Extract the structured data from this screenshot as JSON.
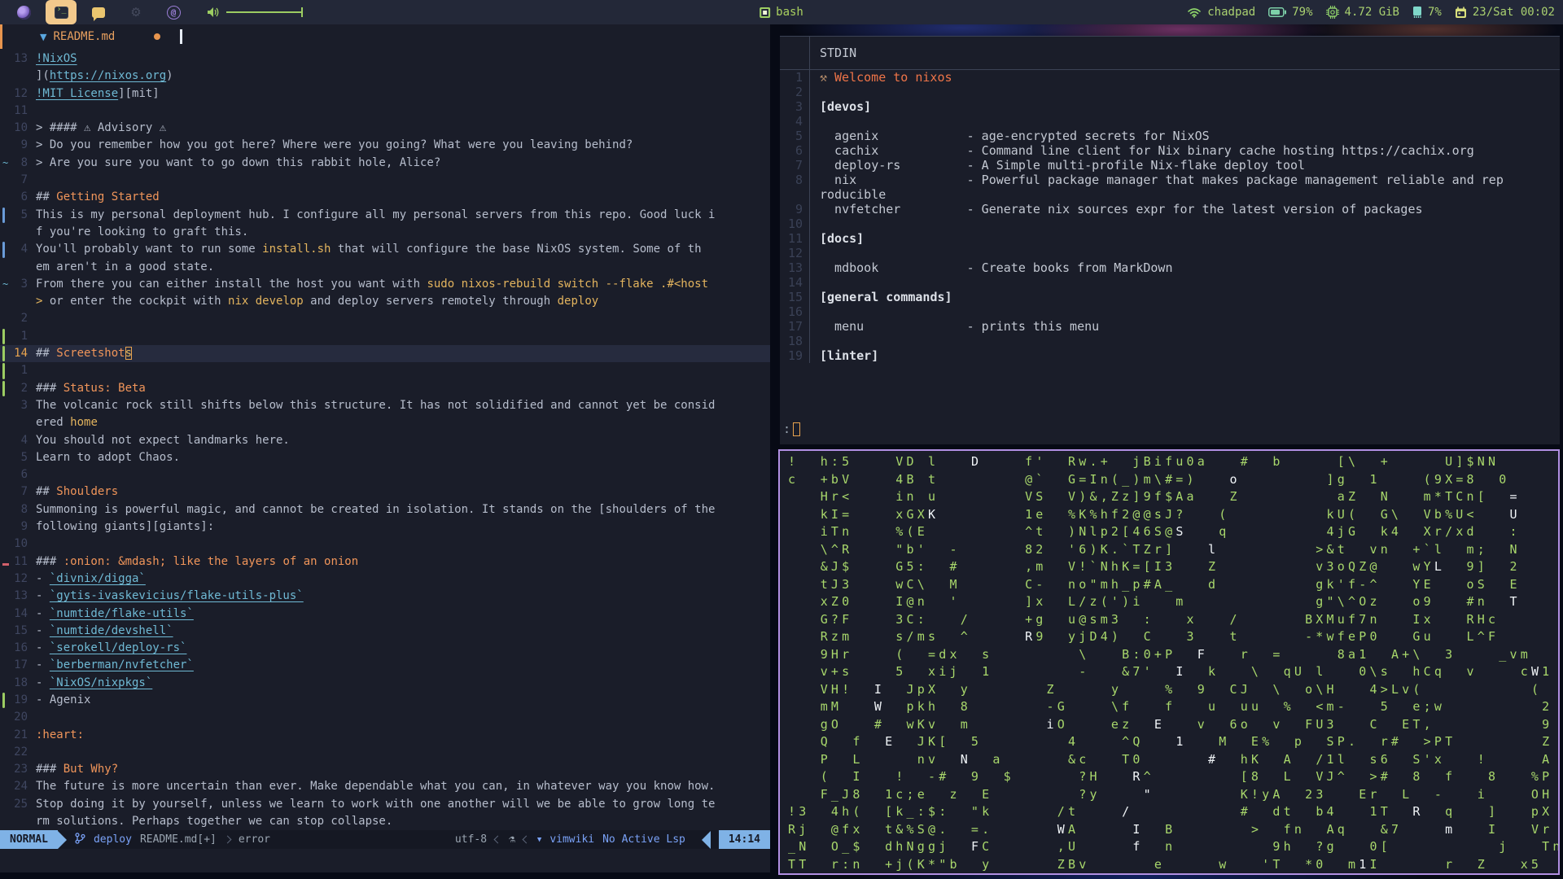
{
  "colors": {
    "accent_orange": "#f0955a",
    "accent_blue": "#7aa2f7",
    "green": "#a9d070",
    "link_cyan": "#6fb9d4",
    "code_yellow": "#e3b45e",
    "matrix_green": "#a8d76b",
    "window_border": "#b18fe2",
    "mode_bg": "#7fb2e6"
  },
  "topbar": {
    "workspaces": [
      {
        "name": "browser",
        "active": false
      },
      {
        "name": "terminal",
        "active": true
      },
      {
        "name": "chat",
        "active": false
      },
      {
        "name": "settings",
        "active": false
      },
      {
        "name": "social",
        "active": false
      }
    ],
    "center": {
      "window_title": "bash"
    },
    "tray": {
      "host": "chadpad",
      "battery": "79%",
      "memory": "4.72 GiB",
      "cpu": "7%",
      "clock": "23/Sat 00:02"
    }
  },
  "editor": {
    "tab": {
      "filename": "README.md",
      "modified": true
    },
    "rows": [
      {
        "n": "13",
        "g": "",
        "s": [
          [
            "l",
            "!NixOS"
          ]
        ]
      },
      {
        "n": "",
        "g": "",
        "s": [
          [
            "t",
            "]("
          ],
          [
            "l",
            "https://nixos.org"
          ],
          [
            "t",
            ")"
          ]
        ]
      },
      {
        "n": "12",
        "g": "",
        "s": [
          [
            "l",
            "!MIT License"
          ],
          [
            "t",
            "][mit]"
          ]
        ]
      },
      {
        "n": "11",
        "g": "",
        "s": []
      },
      {
        "n": "10",
        "g": "",
        "s": [
          [
            "t",
            "> #### ⚠ Advisory ⚠"
          ]
        ]
      },
      {
        "n": "9",
        "g": "",
        "s": [
          [
            "t",
            "> Do you remember how you got here? Where were you going? What were you leaving behind?"
          ]
        ]
      },
      {
        "n": "8",
        "g": "t",
        "s": [
          [
            "t",
            "> Are you sure you want to go down this rabbit hole, Alice?"
          ]
        ]
      },
      {
        "n": "7",
        "g": "",
        "s": []
      },
      {
        "n": "6",
        "g": "",
        "s": [
          [
            "t",
            "## "
          ],
          [
            "h",
            "Getting Started"
          ]
        ]
      },
      {
        "n": "5",
        "g": "b",
        "s": [
          [
            "t",
            "This is my personal deployment hub. I configure all my personal servers from this repo. Good luck i"
          ]
        ]
      },
      {
        "n": "",
        "g": "",
        "s": [
          [
            "t",
            "f you're looking to graft this."
          ]
        ]
      },
      {
        "n": "4",
        "g": "b",
        "s": [
          [
            "t",
            "You'll probably want to run some "
          ],
          [
            "c",
            "install.sh"
          ],
          [
            "t",
            " that will configure the base NixOS system. Some of th"
          ]
        ]
      },
      {
        "n": "",
        "g": "",
        "s": [
          [
            "t",
            "em aren't in a good state."
          ]
        ]
      },
      {
        "n": "3",
        "g": "t",
        "s": [
          [
            "t",
            "From there you can either install the host you want with "
          ],
          [
            "c",
            "sudo nixos-rebuild switch --flake .#<host"
          ]
        ]
      },
      {
        "n": "",
        "g": "",
        "s": [
          [
            "c",
            "> "
          ],
          [
            "t",
            "or enter the cockpit with "
          ],
          [
            "c",
            "nix develop"
          ],
          [
            "t",
            " and deploy servers remotely through "
          ],
          [
            "c",
            "deploy"
          ]
        ]
      },
      {
        "n": "2",
        "g": "",
        "s": []
      },
      {
        "n": "1",
        "g": "g",
        "s": []
      },
      {
        "n": "14",
        "g": "g",
        "cur": true,
        "s": [
          [
            "t",
            "## "
          ],
          [
            "h",
            "Screetshot"
          ],
          [
            "x",
            "s"
          ]
        ]
      },
      {
        "n": "1",
        "g": "g",
        "s": []
      },
      {
        "n": "2",
        "g": "g",
        "s": [
          [
            "t",
            "### "
          ],
          [
            "h",
            "Status: Beta"
          ]
        ]
      },
      {
        "n": "3",
        "g": "",
        "s": [
          [
            "t",
            "The volcanic rock still shifts below this structure. It has not solidified and cannot yet be consid"
          ]
        ]
      },
      {
        "n": "",
        "g": "",
        "s": [
          [
            "t",
            "ered "
          ],
          [
            "c",
            "home"
          ]
        ]
      },
      {
        "n": "4",
        "g": "",
        "s": [
          [
            "t",
            "You should not expect landmarks here."
          ]
        ]
      },
      {
        "n": "5",
        "g": "",
        "s": [
          [
            "t",
            "Learn to adopt Chaos."
          ]
        ]
      },
      {
        "n": "6",
        "g": "",
        "s": []
      },
      {
        "n": "7",
        "g": "",
        "s": [
          [
            "t",
            "## "
          ],
          [
            "h",
            "Shoulders"
          ]
        ]
      },
      {
        "n": "8",
        "g": "",
        "s": [
          [
            "t",
            "Summoning is powerful magic, and cannot be created in isolation. It stands on the [shoulders of the"
          ]
        ]
      },
      {
        "n": "9",
        "g": "",
        "s": [
          [
            "t",
            "following giants][giants]:"
          ]
        ]
      },
      {
        "n": "10",
        "g": "",
        "s": []
      },
      {
        "n": "11",
        "g": "r",
        "s": [
          [
            "t",
            "### "
          ],
          [
            "h",
            ":onion: &mdash; like the layers of an onion"
          ]
        ]
      },
      {
        "n": "12",
        "g": "",
        "s": [
          [
            "t",
            "- "
          ],
          [
            "l",
            "`divnix/digga`"
          ]
        ]
      },
      {
        "n": "13",
        "g": "",
        "s": [
          [
            "t",
            "- "
          ],
          [
            "l",
            "`gytis-ivaskevicius/flake-utils-plus`"
          ]
        ]
      },
      {
        "n": "14",
        "g": "",
        "s": [
          [
            "t",
            "- "
          ],
          [
            "l",
            "`numtide/flake-utils`"
          ]
        ]
      },
      {
        "n": "15",
        "g": "",
        "s": [
          [
            "t",
            "- "
          ],
          [
            "l",
            "`numtide/devshell`"
          ]
        ]
      },
      {
        "n": "16",
        "g": "",
        "s": [
          [
            "t",
            "- "
          ],
          [
            "l",
            "`serokell/deploy-rs`"
          ]
        ]
      },
      {
        "n": "17",
        "g": "",
        "s": [
          [
            "t",
            "- "
          ],
          [
            "l",
            "`berberman/nvfetcher`"
          ]
        ]
      },
      {
        "n": "18",
        "g": "",
        "s": [
          [
            "t",
            "- "
          ],
          [
            "l",
            "`NixOS/nixpkgs`"
          ]
        ]
      },
      {
        "n": "19",
        "g": "g",
        "s": [
          [
            "t",
            "- Agenix"
          ]
        ]
      },
      {
        "n": "20",
        "g": "",
        "s": []
      },
      {
        "n": "21",
        "g": "",
        "s": [
          [
            "h",
            ":heart:"
          ]
        ]
      },
      {
        "n": "22",
        "g": "",
        "s": []
      },
      {
        "n": "23",
        "g": "",
        "s": [
          [
            "t",
            "### "
          ],
          [
            "h",
            "But Why?"
          ]
        ]
      },
      {
        "n": "24",
        "g": "",
        "s": [
          [
            "t",
            "The future is more uncertain than ever. Make dependable what you can, in whatever way you know how."
          ]
        ]
      },
      {
        "n": "25",
        "g": "",
        "s": [
          [
            "t",
            "Stop doing it by yourself, unless we learn to work with one another will we be able to grow long te"
          ]
        ]
      },
      {
        "n": "",
        "g": "",
        "s": [
          [
            "t",
            "rm solutions. Perhaps together we can stop collapse."
          ]
        ]
      }
    ],
    "statusbar": {
      "mode": "NORMAL",
      "branch": "deploy",
      "file": "README.md[+]",
      "diagnostic": "error",
      "encoding": "utf-8",
      "filetype_icon": "⚗",
      "plugin_icon": "▼",
      "plugin": "vimwiki",
      "lsp": "No Active Lsp",
      "time": "14:14"
    }
  },
  "pager": {
    "title": "STDIN",
    "welcome_icon": "⚒",
    "prompt": ":",
    "rows": [
      {
        "n": "1",
        "c": "wel",
        "t": "Welcome to nixos"
      },
      {
        "n": "2",
        "c": "it",
        "t": ""
      },
      {
        "n": "3",
        "c": "sec",
        "t": "[devos]"
      },
      {
        "n": "4",
        "c": "it",
        "t": ""
      },
      {
        "n": "5",
        "c": "it",
        "t": "  agenix            - age-encrypted secrets for NixOS"
      },
      {
        "n": "6",
        "c": "it",
        "t": "  cachix            - Command line client for Nix binary cache hosting https://cachix.org"
      },
      {
        "n": "7",
        "c": "it",
        "t": "  deploy-rs         - A Simple multi-profile Nix-flake deploy tool"
      },
      {
        "n": "8",
        "c": "it",
        "t": "  nix               - Powerful package manager that makes package management reliable and rep"
      },
      {
        "n": "",
        "c": "it",
        "t": "roducible"
      },
      {
        "n": "9",
        "c": "it",
        "t": "  nvfetcher         - Generate nix sources expr for the latest version of packages"
      },
      {
        "n": "10",
        "c": "it",
        "t": ""
      },
      {
        "n": "11",
        "c": "sec",
        "t": "[docs]"
      },
      {
        "n": "12",
        "c": "it",
        "t": ""
      },
      {
        "n": "13",
        "c": "it",
        "t": "  mdbook            - Create books from MarkDown"
      },
      {
        "n": "14",
        "c": "it",
        "t": ""
      },
      {
        "n": "15",
        "c": "sec",
        "t": "[general commands]"
      },
      {
        "n": "16",
        "c": "it",
        "t": ""
      },
      {
        "n": "17",
        "c": "it",
        "t": "  menu              - prints this menu"
      },
      {
        "n": "18",
        "c": "it",
        "t": ""
      },
      {
        "n": "19",
        "c": "sec",
        "t": "[linter]"
      }
    ]
  },
  "matrix": {
    "rows": [
      "!  h:5    VD l   §D§    f'  Rw.+  jBifu0a   #  b     [\\  +     U]$NN",
      "c  +bV    4B t        @`  G=In(_)m\\#=)   §o§        ]g  1    (9X=8  0",
      "   Hr<    in u        VS  V)&,Zz]9f$Aa   Z         aZ  N   m*TCn[  §=§",
      "   kI=    xGX§K§        1e  %K%hf2@@sJ?   (         kU(  G\\  Vb%U<   §U§",
      "   iTn    %(E         ^t  )Nlp2[46S@§S§   q         4jG  k4  Xr/xd   :",
      "   \\^R    \"b'  -      82  '6)K.`TZr]   §l§         >&t  vn  +`l  m;  N",
      "   &J$    G5:  #      ,m  V!`NhK=[I3   Z         v3oQZ@   wY§L§  9]  2",
      "   tJ3    wC\\  M      C-  no\"mh_p#A_   d         gk'f-^   YE   oS  E",
      "   xZ0    I@n  '      ]x  L/z(')i   m            g\"\\^Oz   o9   #n  §T§",
      "   G?F    3C:   /     +g  u@sm3  :   x   /      BXMuf7n   Ix   RHc",
      "   Rzm    s/ms  ^     §R§9  yjD4)  C   3   t      -*wfeP0   Gu   L^F",
      "   9Hr    (  =dx  s        \\   B:0+P  §F§   r  =     8a1  A+\\  3    _vm",
      "   v+s    5  xij  1        -   &7'  §I§  k   \\  qU l   0\\s  hCq  v    c§W§1",
      "   VH!  §I§  JpX  y       Z     y    %  9  CJ  \\  o\\H   4>Lv(          (",
      "   mM   §W§  pkh  8       -G    \\f   f   u  uu  %  <m-   5  e;w         2",
      "   gO   #  wKv  m       §i§O    ez  §E§   v  6o  v  FU3   C  ET,          9",
      "   Q  f  §E§  JK[  5        4    ^Q   §1§   M  E%  p  SP.  r#  >PT        Z",
      "   P  L     nv  §N§  a      &c   T0      §#§  hK  A  /1l  s6  S'x   !     A",
      "   (  I   !  -#  9  $      ?H   §R§^        [8  L  VJ^  >#  8  f   8   %P",
      "   F_J8  1c;e  z  E        ?y    §\"§        K!yA  23   Er  L  -   i    OH",
      "!3  4h(  [k_:$:  \"k      /t    §/§          #  dt  b4   1T  §R§  q   ]   pX",
      "Rj  @fx  t&%S@.  =.      §W§A     §I§  B       >  fn  Aq   &7    §m§   I   Vr",
      "_N  O_$  dhNggj  §F§C      ,U     §f§  n         9h  ?g   0[          j   Tn",
      "TT  r:n  +j(K*\"b  y      ZBv      e     w   'T  *0  m§1§I      r  Z   x5"
    ]
  }
}
